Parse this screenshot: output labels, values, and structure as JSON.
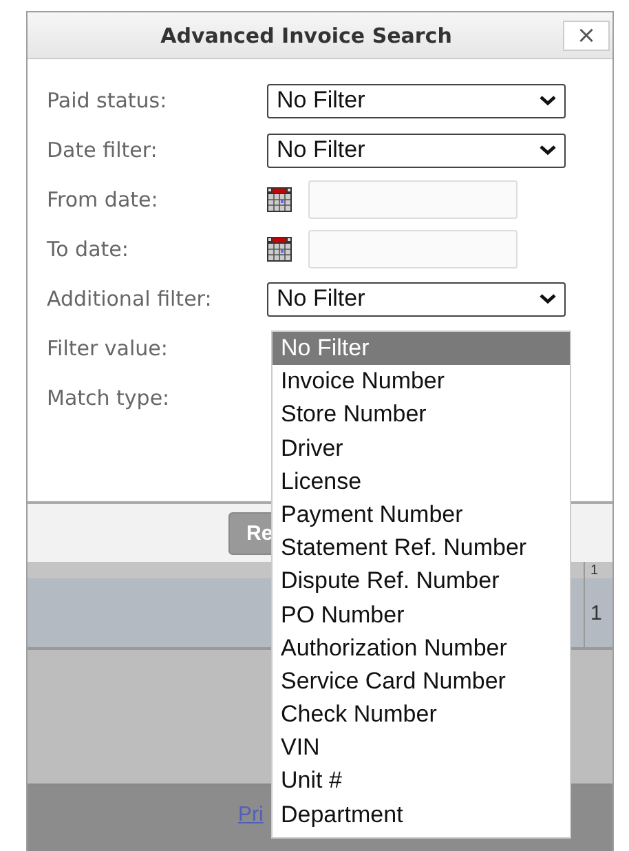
{
  "dialog": {
    "title": "Advanced Invoice Search",
    "close": "×",
    "fields": [
      {
        "label": "Paid status:",
        "kind": "select",
        "value": "No Filter"
      },
      {
        "label": "Date filter:",
        "kind": "select",
        "value": "No Filter"
      },
      {
        "label": "From date:",
        "kind": "date"
      },
      {
        "label": "To date:",
        "kind": "date"
      },
      {
        "label": "Additional filter:",
        "kind": "select",
        "value": "No Filter"
      },
      {
        "label": "Filter value:",
        "kind": "blank"
      },
      {
        "label": "Match type:",
        "kind": "blank"
      }
    ],
    "button": "Re",
    "dropdown": [
      {
        "label": "No Filter",
        "selected": true
      },
      {
        "label": "Invoice Number",
        "selected": false
      },
      {
        "label": "Store Number",
        "selected": false
      },
      {
        "label": "Driver",
        "selected": false
      },
      {
        "label": "License",
        "selected": false
      },
      {
        "label": "Payment Number",
        "selected": false
      },
      {
        "label": "Statement Ref. Number",
        "selected": false
      },
      {
        "label": "Dispute Ref. Number",
        "selected": false
      },
      {
        "label": "PO Number",
        "selected": false
      },
      {
        "label": "Authorization Number",
        "selected": false
      },
      {
        "label": "Service Card Number",
        "selected": false
      },
      {
        "label": "Check Number",
        "selected": false
      },
      {
        "label": "VIN",
        "selected": false
      },
      {
        "label": "Unit #",
        "selected": false
      },
      {
        "label": "Department",
        "selected": false
      }
    ]
  },
  "background": {
    "cells": [
      "1",
      "1"
    ],
    "link": "Pri"
  }
}
